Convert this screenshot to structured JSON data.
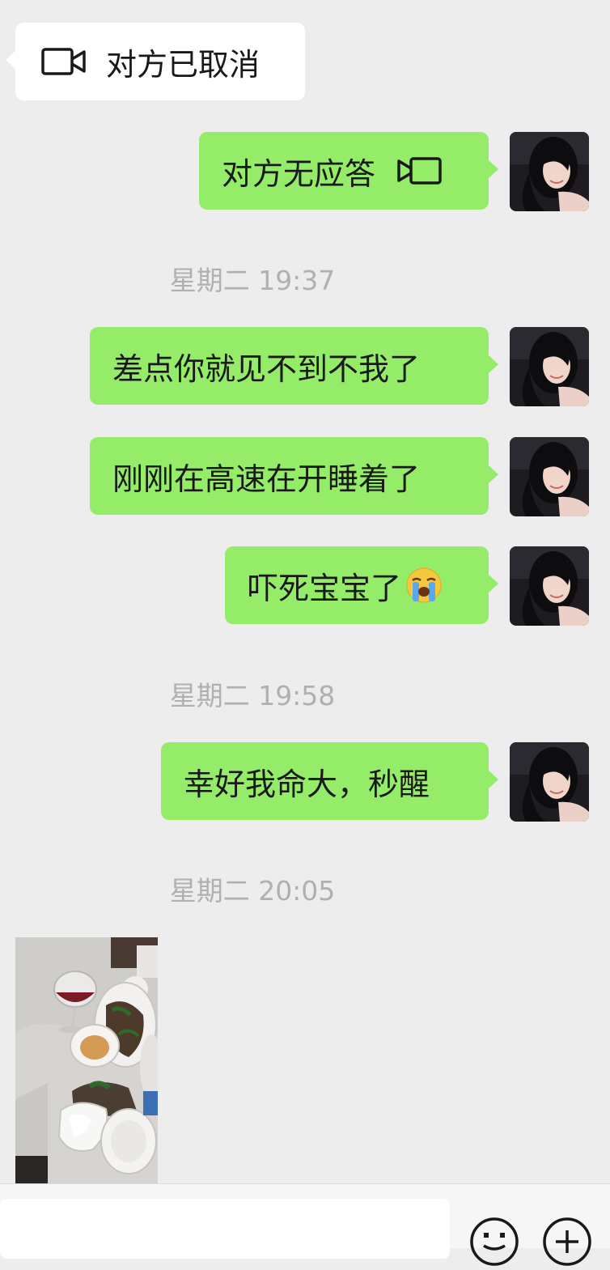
{
  "messages": {
    "call_cancelled": "对方已取消",
    "call_no_answer": "对方无应答",
    "msg1": "差点你就见不到不我了",
    "msg2": "刚刚在高速在开睡着了",
    "msg3": "吓死宝宝了",
    "msg3_emoji": "crying-face-emoji",
    "msg4": "幸好我命大，秒醒"
  },
  "timestamps": {
    "t1": "星期二 19:37",
    "t2": "星期二 19:58",
    "t3": "星期二 20:05"
  },
  "colors": {
    "outgoing_bubble": "#95ec69",
    "incoming_bubble": "#ffffff",
    "background": "#ededed",
    "timestamp_text": "#b0b0b0"
  },
  "icons": {
    "video_call": "video-camera-icon",
    "emoji_button": "smiley-icon",
    "more_button": "plus-circle-icon"
  }
}
